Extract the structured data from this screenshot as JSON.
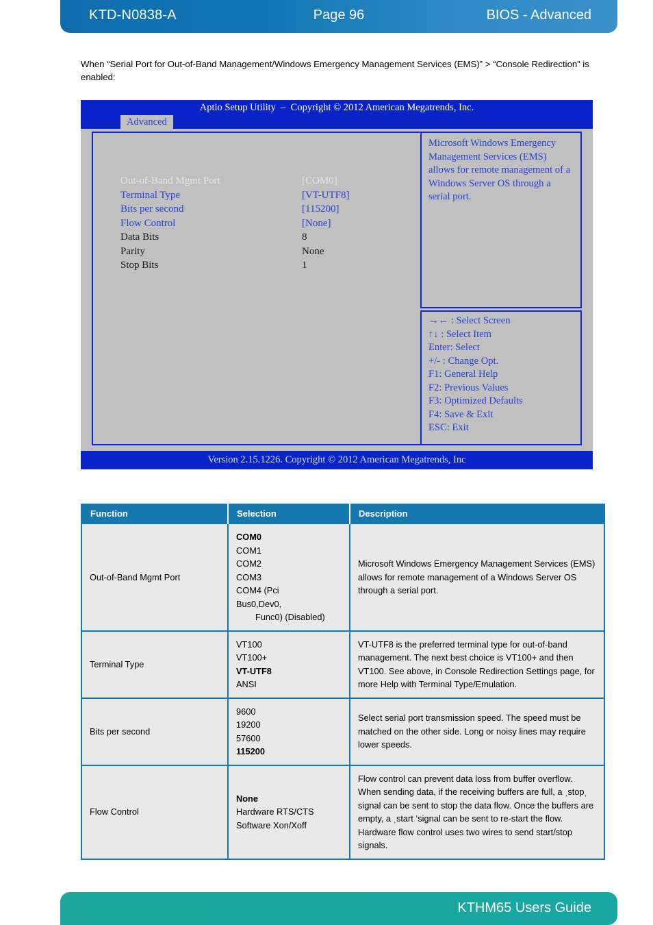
{
  "header": {
    "doc_id": "KTD-N0838-A",
    "page_label": "Page 96",
    "section": "BIOS - Advanced"
  },
  "intro": {
    "text": "When “Serial Port for Out-of-Band Management/Windows Emergency Management Services (EMS)” > “Console Redirection” is enabled:"
  },
  "bios": {
    "title": "Aptio Setup Utility  –  Copyright © 2012 American Megatrends, Inc.",
    "tab": "Advanced",
    "items": [
      {
        "label": "Out-of-Band Mgmt Port",
        "value": "[COM0]",
        "state": "sel"
      },
      {
        "label": "Terminal Type",
        "value": "[VT-UTF8]",
        "state": "edit"
      },
      {
        "label": "Bits per second",
        "value": "[115200]",
        "state": "edit"
      },
      {
        "label": "Flow Control",
        "value": "[None]",
        "state": "edit"
      },
      {
        "label": "Data Bits",
        "value": "8",
        "state": "ro"
      },
      {
        "label": "Parity",
        "value": "None",
        "state": "ro"
      },
      {
        "label": "Stop Bits",
        "value": "1",
        "state": "ro"
      }
    ],
    "help_text": "Microsoft Windows Emergency Management Services (EMS) allows for remote management of a Windows Server OS through a serial port.",
    "keys": [
      "→← : Select Screen",
      "↑↓ : Select Item",
      "Enter: Select",
      "+/- : Change Opt.",
      "F1: General Help",
      "F2: Previous Values",
      "F3: Optimized Defaults",
      "F4: Save & Exit",
      "ESC: Exit"
    ],
    "version": "Version 2.15.1226. Copyright © 2012 American Megatrends, Inc"
  },
  "table": {
    "columns": [
      "Function",
      "Selection",
      "Description"
    ],
    "rows": [
      {
        "function": "Out-of-Band Mgmt Port",
        "selection": [
          {
            "text": "COM0",
            "bold": true,
            "indent": false
          },
          {
            "text": "COM1",
            "bold": false,
            "indent": false
          },
          {
            "text": "COM2",
            "bold": false,
            "indent": false
          },
          {
            "text": "COM3",
            "bold": false,
            "indent": false
          },
          {
            "text": "COM4 (Pci",
            "bold": false,
            "indent": false
          },
          {
            "text": "Bus0,Dev0,",
            "bold": false,
            "indent": false
          },
          {
            "text": "Func0) (Disabled)",
            "bold": false,
            "indent": true
          }
        ],
        "description": "Microsoft Windows Emergency Management Services (EMS) allows for remote management of a Windows Server OS through a serial port."
      },
      {
        "function": "Terminal Type",
        "selection": [
          {
            "text": "VT100",
            "bold": false,
            "indent": false
          },
          {
            "text": "VT100+",
            "bold": false,
            "indent": false
          },
          {
            "text": "VT-UTF8",
            "bold": true,
            "indent": false
          },
          {
            "text": "ANSI",
            "bold": false,
            "indent": false
          }
        ],
        "description": "VT-UTF8 is the preferred terminal type for out-of-band management. The next best choice is VT100+ and then VT100. See above, in Console Redirection Settings page, for more Help with Terminal Type/Emulation."
      },
      {
        "function": "Bits per second",
        "selection": [
          {
            "text": "9600",
            "bold": false,
            "indent": false
          },
          {
            "text": "19200",
            "bold": false,
            "indent": false
          },
          {
            "text": "57600",
            "bold": false,
            "indent": false
          },
          {
            "text": "115200",
            "bold": true,
            "indent": false
          }
        ],
        "description": "Select serial port transmission speed. The speed must be matched on the other side. Long or noisy lines may require lower speeds."
      },
      {
        "function": "Flow Control",
        "selection": [
          {
            "text": "None",
            "bold": true,
            "indent": false
          },
          {
            "text": "Hardware RTS/CTS",
            "bold": false,
            "indent": false
          },
          {
            "text": "Software Xon/Xoff",
            "bold": false,
            "indent": false
          }
        ],
        "description": "Flow control can prevent data loss from buffer overflow. When sending data, if the receiving buffers are full, a ˌstopˌ signal can be sent to stop the data flow. Once the buffers are empty, a ˌstart ‘signal can be sent to re-start the flow. Hardware flow control uses two wires to send start/stop signals."
      }
    ]
  },
  "footer": {
    "guide_title": "KTHM65 Users Guide"
  }
}
